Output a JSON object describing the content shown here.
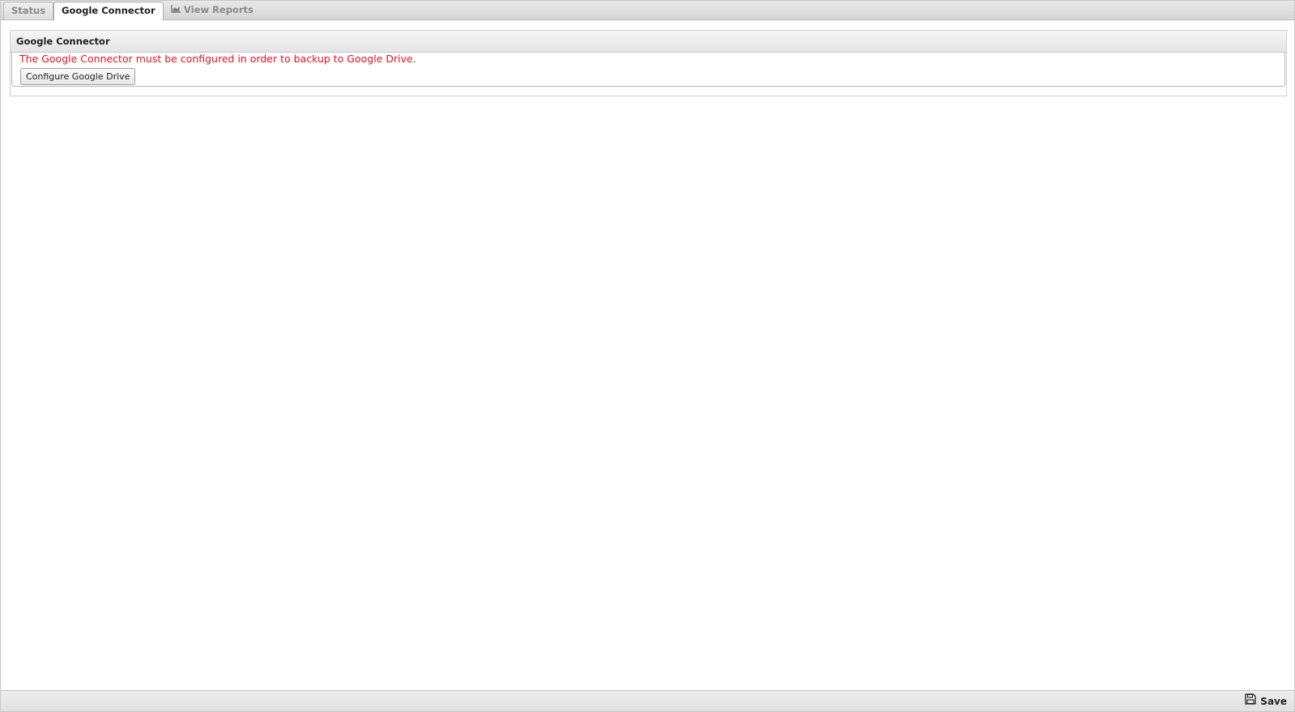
{
  "tabs": [
    {
      "label": "Status",
      "active": false
    },
    {
      "label": "Google Connector",
      "active": true
    },
    {
      "label": "View Reports",
      "active": false,
      "icon": "chart-icon"
    }
  ],
  "panel": {
    "title": "Google Connector",
    "warning": "The Google Connector must be configured in order to backup to Google Drive.",
    "configure_button": "Configure Google Drive"
  },
  "footer": {
    "save_label": "Save",
    "save_icon": "floppy-disk-icon"
  },
  "colors": {
    "warning_text": "#e8101a",
    "tabbar_background": "#dcdcdc",
    "footer_background": "#e6e6e6"
  }
}
